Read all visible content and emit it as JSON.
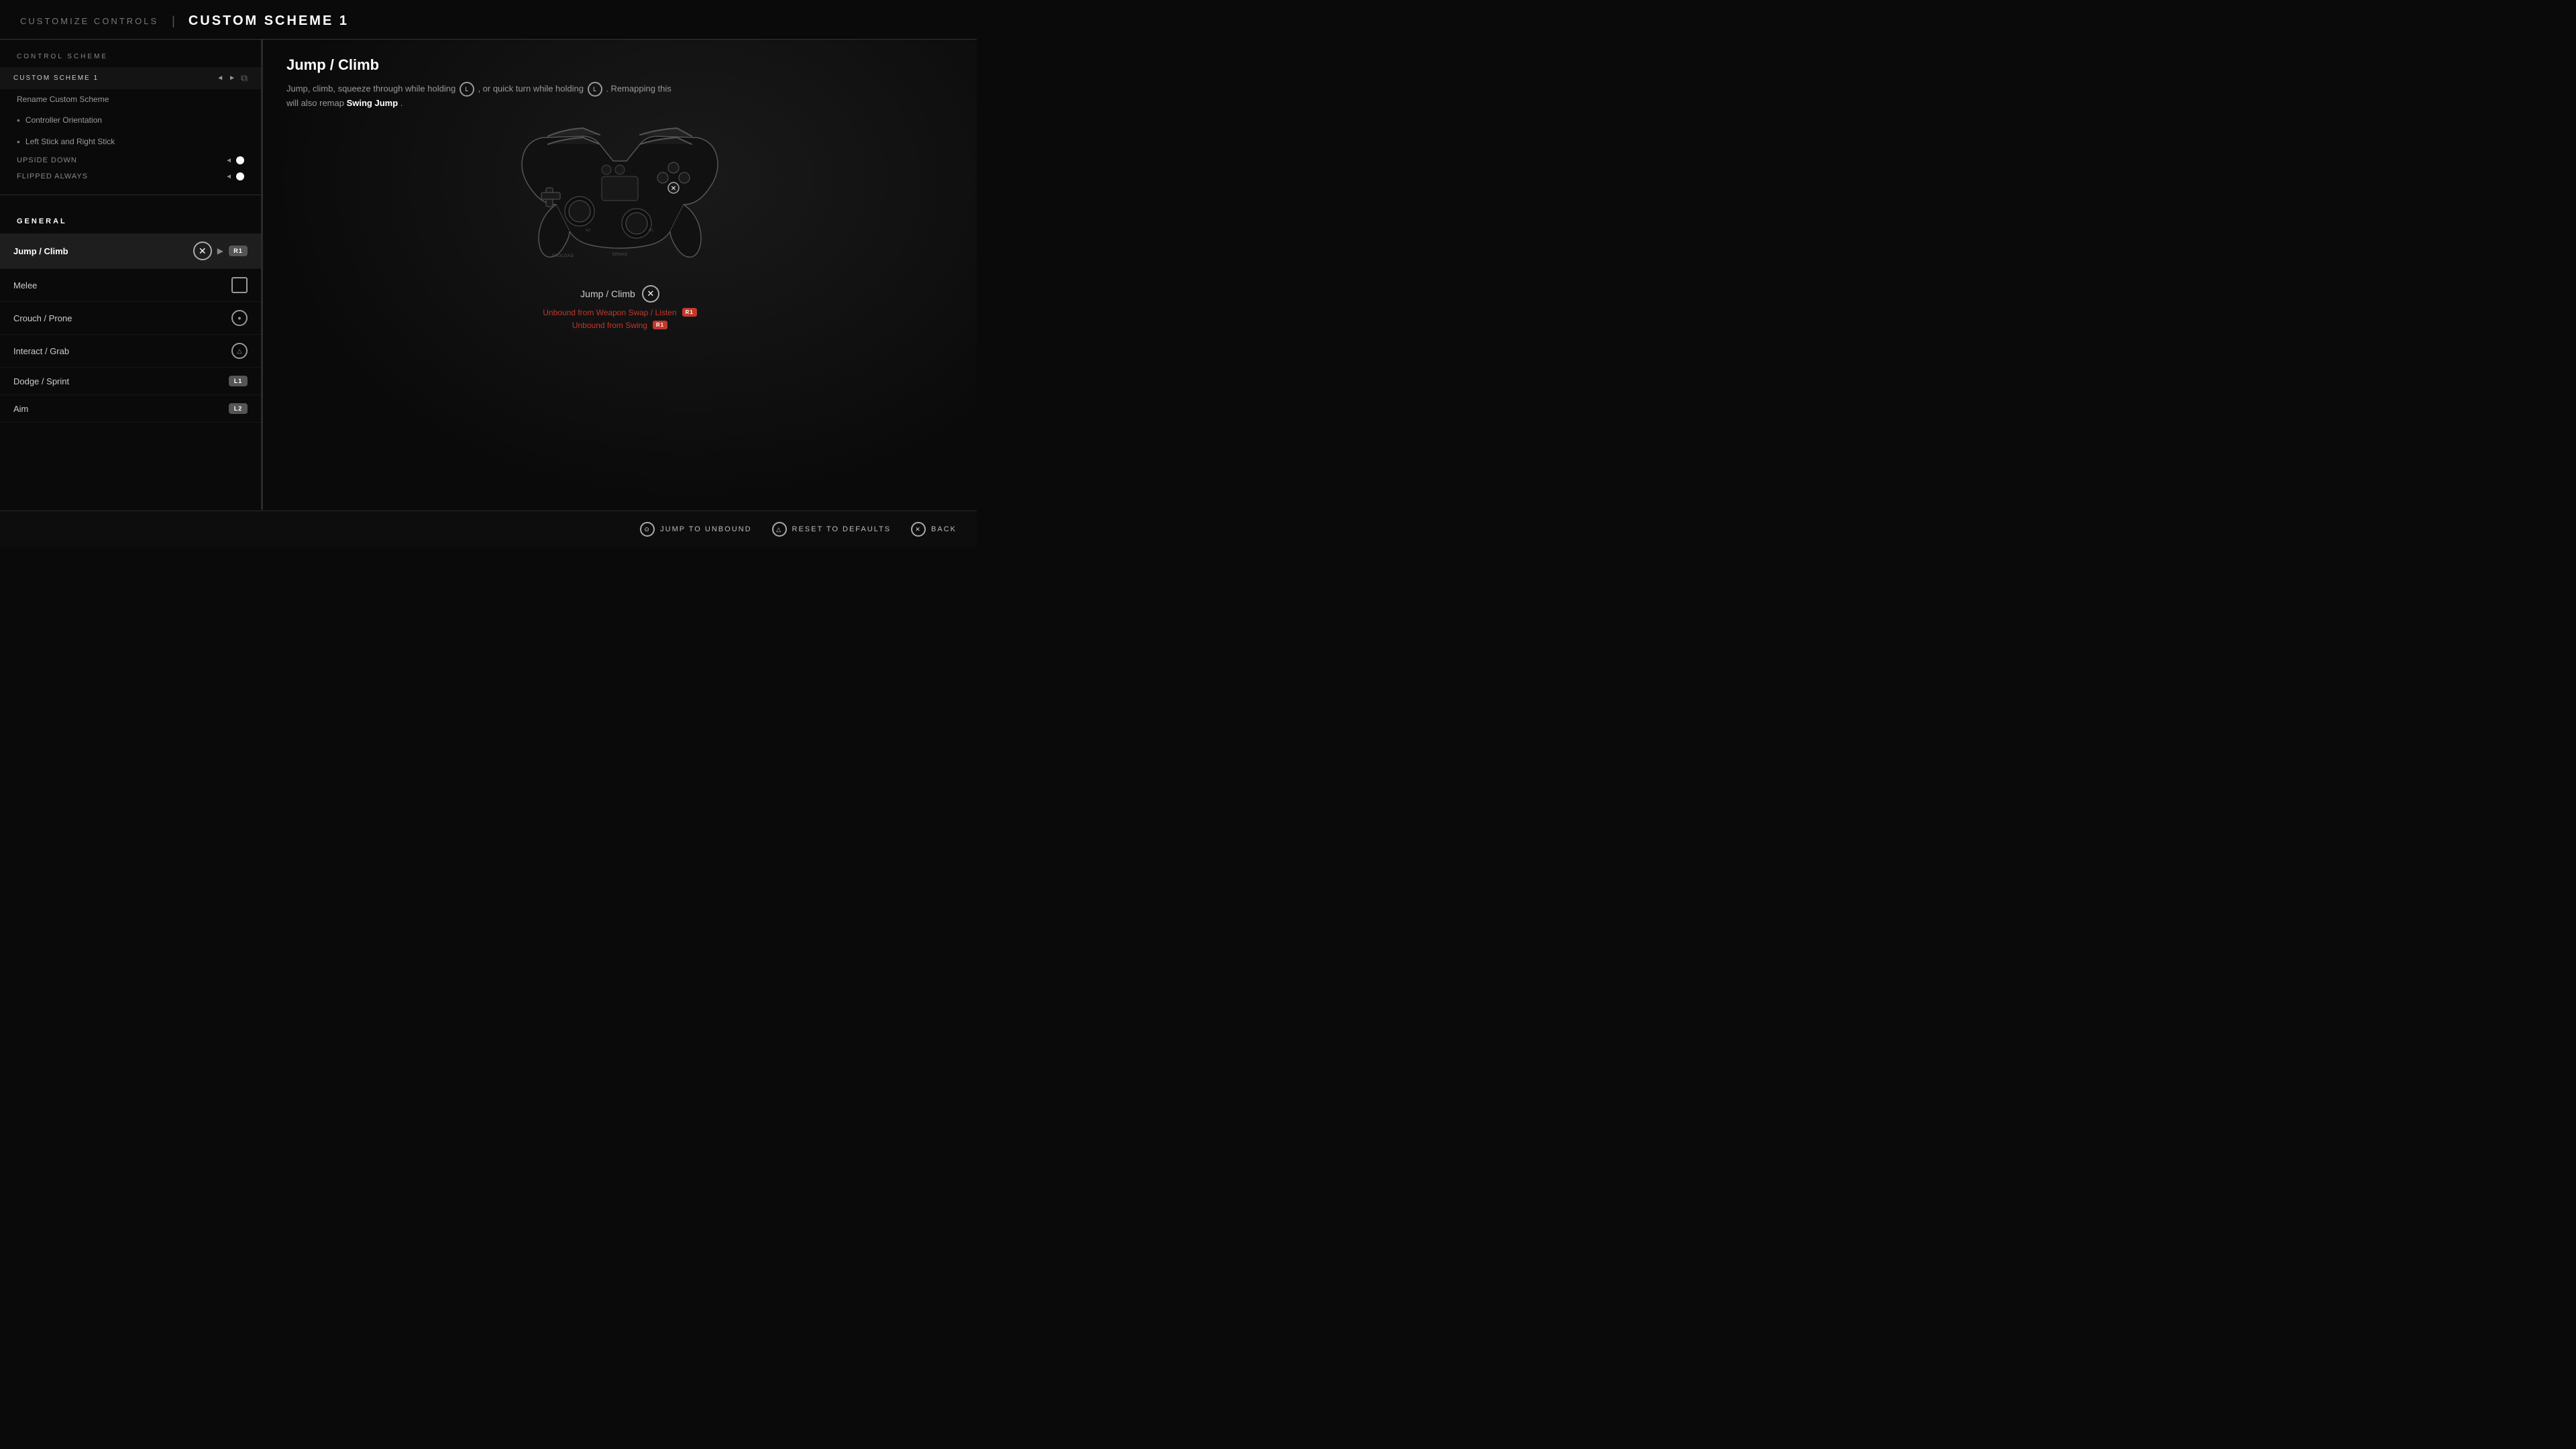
{
  "header": {
    "subtitle": "CUSTOMIZE CONTROLS",
    "divider": "|",
    "title": "CUSTOM SCHEME 1"
  },
  "left_panel": {
    "section_label": "CONTROL SCHEME",
    "scheme_selector": {
      "label": "CUSTOM SCHEME 1",
      "left_arrow": "◄",
      "right_arrow": "►"
    },
    "rename_item": "Rename Custom Scheme",
    "controller_orientation": "Controller Orientation",
    "left_right_stick": "Left Stick and Right Stick",
    "upside_down": {
      "label": "UPSIDE DOWN",
      "arrow": "◄"
    },
    "flipped_always": {
      "label": "FLIPPED ALWAYS",
      "arrow": "◄"
    },
    "general_label": "GENERAL",
    "controls": [
      {
        "name": "Jump / Climb",
        "buttons": [
          "×",
          "▶",
          "R1"
        ],
        "active": true
      },
      {
        "name": "Melee",
        "buttons": [
          "□"
        ],
        "active": false
      },
      {
        "name": "Crouch / Prone",
        "buttons": [
          "⊙"
        ],
        "active": false
      },
      {
        "name": "Interact / Grab",
        "buttons": [
          "△"
        ],
        "active": false
      },
      {
        "name": "Dodge / Sprint",
        "buttons": [
          "L1"
        ],
        "active": false
      },
      {
        "name": "Aim",
        "buttons": [
          "L2"
        ],
        "active": false
      }
    ]
  },
  "right_panel": {
    "action_title": "Jump / Climb",
    "description_parts": [
      "Jump, climb, squeeze through while holding",
      ", or quick turn while holding",
      ". Remapping this will also remap",
      "Swing Jump",
      "."
    ],
    "button_l": "L",
    "controller_alt_text": "PlayStation controller diagram",
    "binding_label": "Jump / Climb",
    "binding_icon": "×",
    "unbound_rows": [
      {
        "text": "Unbound from Weapon Swap / Listen",
        "badge": "R1"
      },
      {
        "text": "Unbound from Swing",
        "badge": "R1"
      }
    ]
  },
  "footer": {
    "jump_to_unbound": {
      "icon": "⊙",
      "label": "JUMP TO UNBOUND"
    },
    "reset_to_defaults": {
      "icon": "△",
      "label": "RESET TO DEFAULTS"
    },
    "back": {
      "icon": "⊗",
      "label": "BACK"
    }
  }
}
